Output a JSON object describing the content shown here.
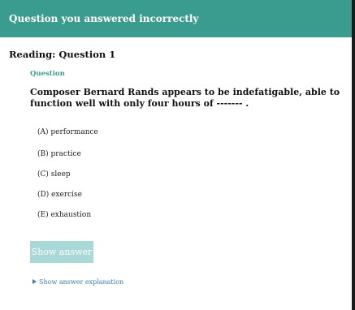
{
  "header": {
    "title": "Question you answered incorrectly"
  },
  "section": {
    "title": "Reading: Question 1"
  },
  "question": {
    "label": "Question",
    "text": "Composer Bernard Rands appears to be indefatigable, able to function well with only four hours of ------- ."
  },
  "options": [
    {
      "label": "(A) performance"
    },
    {
      "label": "(B) practice"
    },
    {
      "label": "(C) sleep"
    },
    {
      "label": "(D) exercise"
    },
    {
      "label": "(E) exhaustion"
    }
  ],
  "actions": {
    "show_answer_label": "Show answer",
    "show_explanation_label": "Show answer explanation",
    "explanation_icon": "triangle-right-icon"
  },
  "colors": {
    "header_bg": "#3a9b8f",
    "accent": "#3a9b8f",
    "button_bg": "#a8d8d8",
    "link": "#3a7fb8"
  }
}
